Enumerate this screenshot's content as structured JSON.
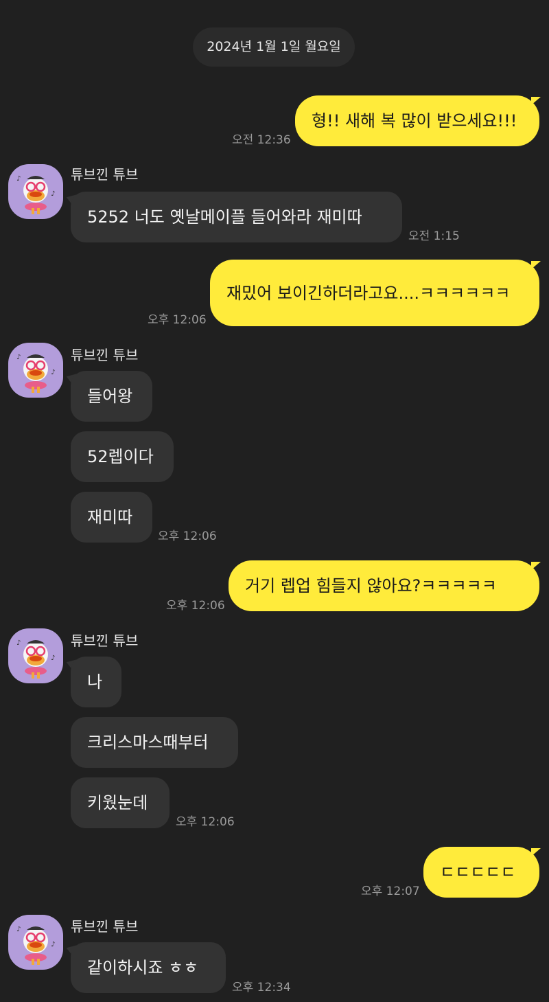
{
  "chat": {
    "date_divider": "2024년 1월 1일 월요일",
    "sender_name": "튜브낀 튜브",
    "accent_color": "#ffeb3b",
    "messages": [
      {
        "dir": "out",
        "text": "형!! 새해 복 많이 받으세요!!!",
        "time": "오전 12:36"
      },
      {
        "dir": "in",
        "text": "5252 너도 옛날메이플 들어와라 재미따",
        "time": "오전 1:15"
      },
      {
        "dir": "out",
        "text": "재밌어 보이긴하더라고요....ㅋㅋㅋㅋㅋㅋ",
        "time": "오후 12:06"
      },
      {
        "dir": "in",
        "text": "들어왕"
      },
      {
        "dir": "in",
        "text": "52렙이다"
      },
      {
        "dir": "in",
        "text": "재미따",
        "time": "오후 12:06"
      },
      {
        "dir": "out",
        "text": "거기 렙업 힘들지 않아요?ㅋㅋㅋㅋㅋ",
        "time": "오후 12:06"
      },
      {
        "dir": "in",
        "text": "나"
      },
      {
        "dir": "in",
        "text": "크리스마스때부터"
      },
      {
        "dir": "in",
        "text": "키웠눈데",
        "time": "오후 12:06"
      },
      {
        "dir": "out",
        "text": "ㄷㄷㄷㄷㄷ",
        "time": "오후 12:07"
      },
      {
        "dir": "in",
        "text": "같이하시죠 ㅎㅎ",
        "time": "오후 12:34"
      }
    ]
  }
}
